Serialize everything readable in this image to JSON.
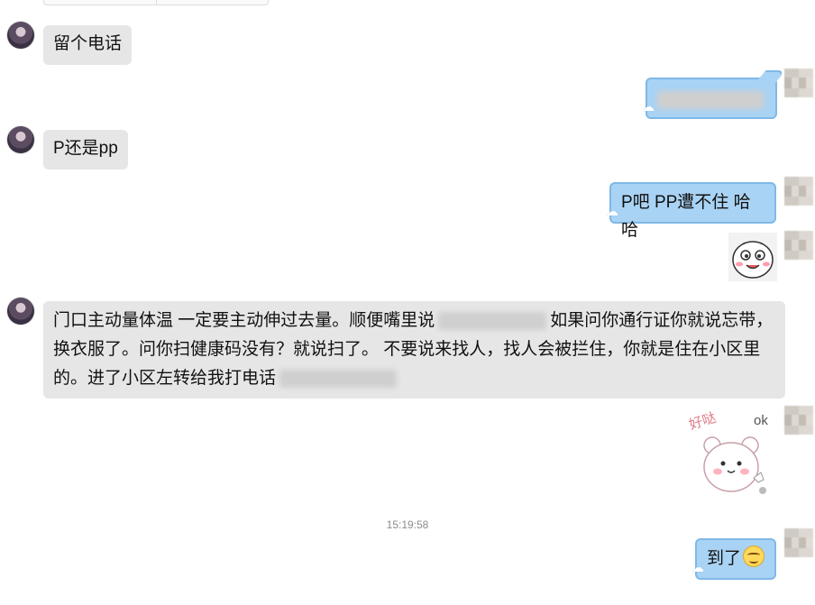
{
  "messages": {
    "m1": "留个电话",
    "m3": "P还是pp",
    "m4": "P吧 PP遭不住 哈哈",
    "m6": {
      "part1": "门口主动量体温 一定要主动伸过去量。顺便嘴里说",
      "part2": "如果问你通行证你就说忘带，",
      "line2": "换衣服了。问你扫健康码没有？就说扫了。 不要说来找人，找人会被拦住，你就是住在小区里",
      "line3": "的。进了小区左转给我打电话"
    },
    "m8": "到了"
  },
  "stickers": {
    "haoda_text": "好哒",
    "ok_text": "ok"
  },
  "timestamp": "15:19:58",
  "colors": {
    "left_bubble": "#e6e6e6",
    "right_bubble": "#a9d3f4",
    "right_border": "#7fb8e6"
  }
}
